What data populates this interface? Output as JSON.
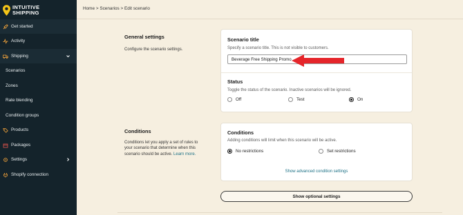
{
  "brand": {
    "line1": "INTUITIVE",
    "line2": "SHIPPING"
  },
  "sidebar": {
    "items": [
      {
        "label": "Get started",
        "icon": "rocket-icon"
      },
      {
        "label": "Activity",
        "icon": "activity-icon"
      },
      {
        "label": "Shipping",
        "icon": "truck-icon",
        "expanded": true
      },
      {
        "label": "Scenarios"
      },
      {
        "label": "Zones"
      },
      {
        "label": "Rate blending"
      },
      {
        "label": "Condition groups"
      },
      {
        "label": "Products",
        "icon": "tag-icon"
      },
      {
        "label": "Packages",
        "icon": "package-icon"
      },
      {
        "label": "Settings",
        "icon": "gear-icon"
      },
      {
        "label": "Shopify connection",
        "icon": "plug-icon"
      }
    ]
  },
  "breadcrumb": {
    "text": "Home > Scenarios > Edit scenario"
  },
  "general": {
    "title": "General settings",
    "description": "Configure the scenario settings."
  },
  "scenario_title": {
    "label": "Scenario title",
    "help": "Specify a scenario title. This is not visible to customers.",
    "value": "Beverage Free Shipping Promo"
  },
  "status": {
    "label": "Status",
    "help": "Toggle the status of the scenario. Inactive scenarios will be ignored.",
    "options": [
      "Off",
      "Test",
      "On"
    ],
    "selected": "On"
  },
  "conditions_section": {
    "title": "Conditions",
    "description": "Conditions let you apply a set of rules to your scenario that determine when this scenario should be active.",
    "link": "Learn more."
  },
  "conditions_card": {
    "label": "Conditions",
    "help": "Adding conditions will limit when this scenario will be active.",
    "options": [
      "No restrictions",
      "Set restrictions"
    ],
    "selected": "No restrictions",
    "advanced_link": "Show advanced condition settings"
  },
  "optional_button": "Show optional settings",
  "colors": {
    "sidebar": "#14232b",
    "accent": "#1a6f84",
    "annotation": "#e5252a",
    "page": "#f6efe0",
    "brand": "#f5c518"
  }
}
